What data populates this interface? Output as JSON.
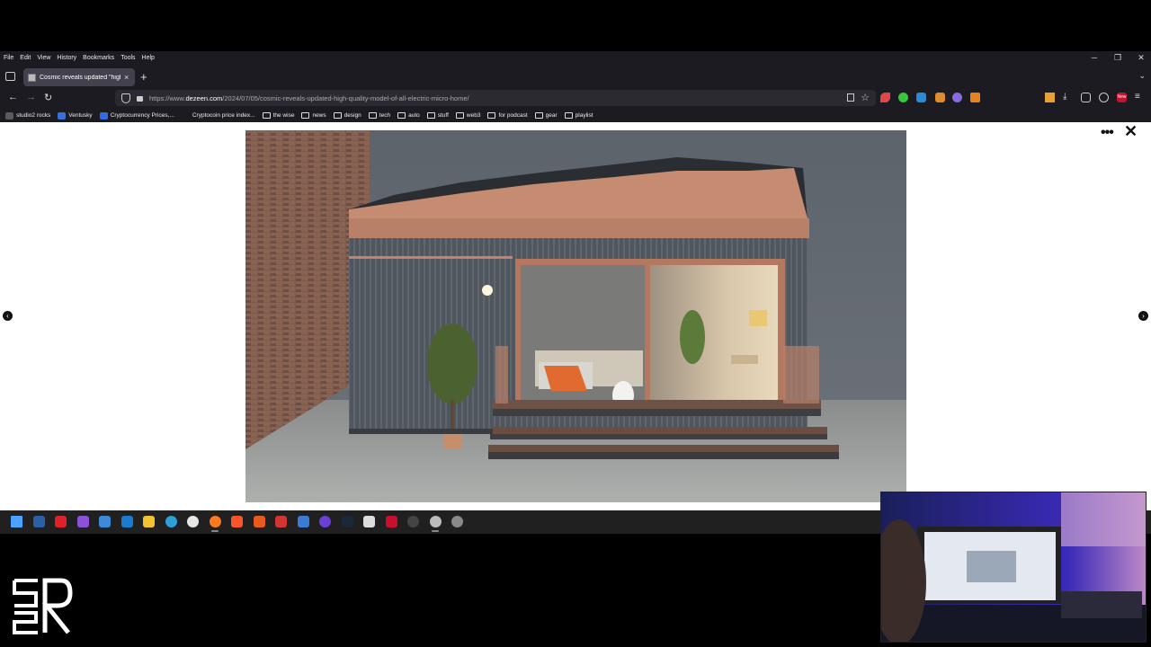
{
  "browser": {
    "menu": [
      "File",
      "Edit",
      "View",
      "History",
      "Bookmarks",
      "Tools",
      "Help"
    ],
    "window_controls": [
      "─",
      "❐",
      "✕"
    ],
    "tab": {
      "title": "Cosmic reveals updated \"high-",
      "close": "×"
    },
    "new_tab": "+",
    "tab_list_chevron": "⌄",
    "nav": {
      "back": "←",
      "forward": "→",
      "reload": "↻"
    },
    "url_prefix": "https://www.",
    "url_domain": "dezeen.com",
    "url_path": "/2024/07/05/cosmic-reveals-updated-high-quality-model-of-all-electric-micro-home/",
    "star": "☆",
    "toolbar_icons": [
      "download-icon",
      "extensions-icon",
      "screenshot-icon",
      "new-badge-icon",
      "menu-icon"
    ],
    "toolbar_glyphs": {
      "download": "⤓",
      "menu": "≡"
    },
    "new_badge": "New",
    "bookmarks": [
      {
        "label": "studio2 rocks",
        "icon": "studio2-icon",
        "color": "#5a5a5a"
      },
      {
        "label": "Ventusky",
        "icon": "ventusky-icon",
        "color": "#3b6fd8"
      },
      {
        "label": "Cryptocurrency Prices,...",
        "icon": "crypto-icon",
        "color": "#2f6de0"
      },
      {
        "label": "Cryptocoin price index...",
        "icon": "cryptocoin-icon",
        "color": "#1c1b22"
      },
      {
        "label": "the wise",
        "icon": "folder-icon"
      },
      {
        "label": "news",
        "icon": "folder-icon"
      },
      {
        "label": "design",
        "icon": "folder-icon"
      },
      {
        "label": "tech",
        "icon": "folder-icon"
      },
      {
        "label": "auto",
        "icon": "folder-icon"
      },
      {
        "label": "stuff",
        "icon": "folder-icon"
      },
      {
        "label": "web3",
        "icon": "folder-icon"
      },
      {
        "label": "for podcast",
        "icon": "folder-icon"
      },
      {
        "label": "gear",
        "icon": "folder-icon"
      },
      {
        "label": "playlist",
        "icon": "folder-icon"
      }
    ]
  },
  "page": {
    "more_label": "•••",
    "close_label": "✕",
    "prev_label": "‹",
    "next_label": "›"
  },
  "taskbar": {
    "icons": [
      {
        "name": "windows-start-icon",
        "color": "#4aa3ff"
      },
      {
        "name": "powershell-icon",
        "color": "#2c5fa8"
      },
      {
        "name": "app-red-icon",
        "color": "#e0202a"
      },
      {
        "name": "visual-studio-icon",
        "color": "#8a52d8"
      },
      {
        "name": "remote-desktop-icon",
        "color": "#3c8ad8"
      },
      {
        "name": "calculator-icon",
        "color": "#1b7bd0"
      },
      {
        "name": "file-explorer-icon",
        "color": "#f1c232"
      },
      {
        "name": "edge-icon",
        "color": "#2ea0d8"
      },
      {
        "name": "itunes-icon",
        "color": "#e6e6e6"
      },
      {
        "name": "firefox-icon",
        "color": "#ff7a1a"
      },
      {
        "name": "brave-icon",
        "color": "#fb542b"
      },
      {
        "name": "app-orange-icon",
        "color": "#e85a1e"
      },
      {
        "name": "app-wave-icon",
        "color": "#d23434"
      },
      {
        "name": "app-blue-square-icon",
        "color": "#3a7bd5"
      },
      {
        "name": "app-circle-icon",
        "color": "#6b3fd8"
      },
      {
        "name": "steam-icon",
        "color": "#1b2838"
      },
      {
        "name": "app-mask-icon",
        "color": "#dddddd"
      },
      {
        "name": "app-badge-icon",
        "color": "#c8102e"
      },
      {
        "name": "app-dark-circle-icon",
        "color": "#444444"
      },
      {
        "name": "chrome-icon",
        "color": "#bbbbbb"
      },
      {
        "name": "settings-icon",
        "color": "#8a8a8a"
      }
    ]
  },
  "colors": {
    "chrome_bg": "#1c1b22",
    "tab_active": "#42414d",
    "urlbar_bg": "#2b2a33",
    "page_bg": "#ffffff",
    "taskbar_bg": "#202020"
  }
}
